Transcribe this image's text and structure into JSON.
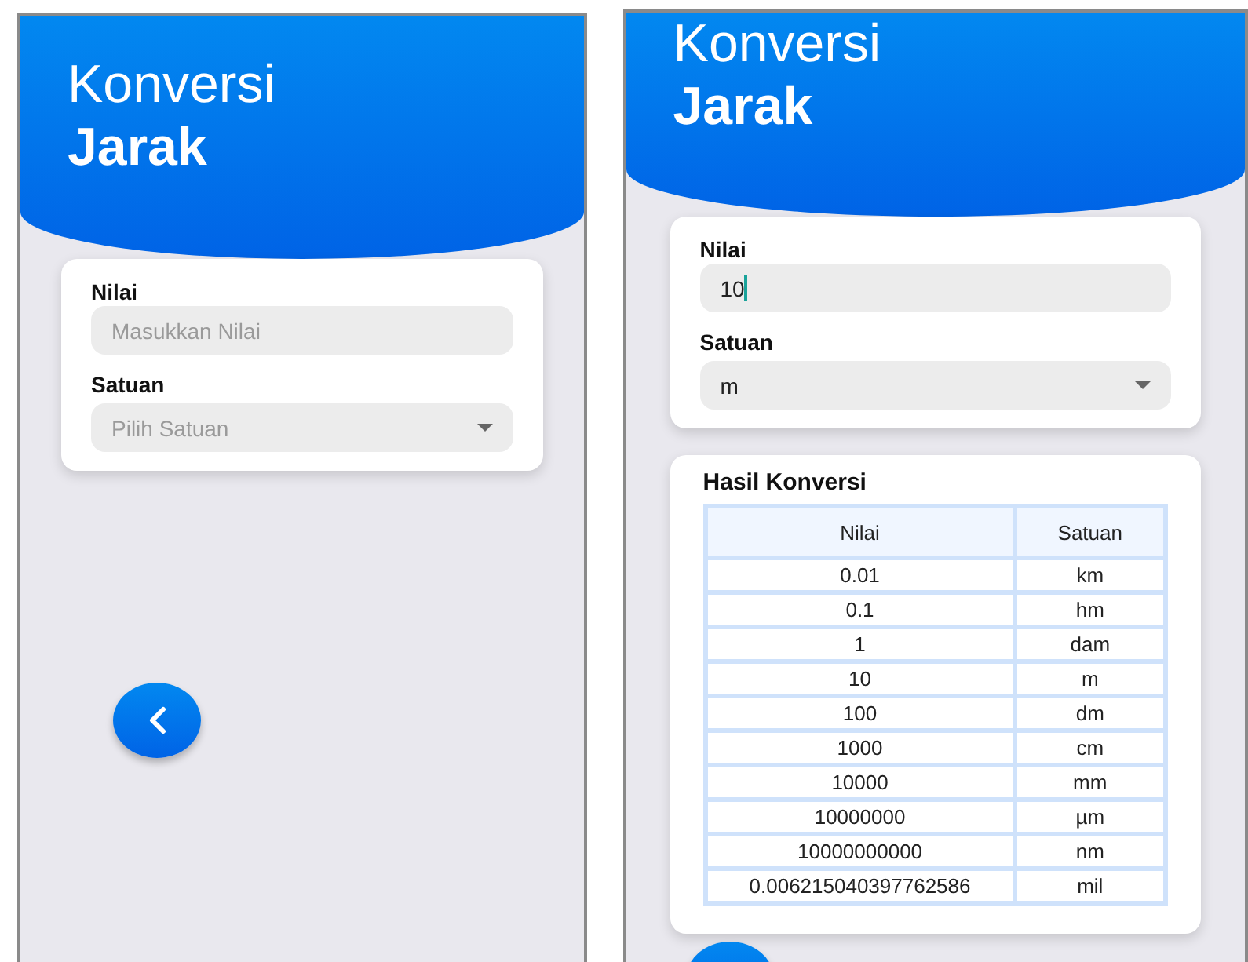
{
  "screens": [
    {
      "title_line1": "Konversi",
      "title_line2": "Jarak",
      "form": {
        "fields": [
          {
            "kind": "input",
            "label": "Nilai",
            "placeholder": "Masukkan Nilai",
            "focused": false
          },
          {
            "kind": "select",
            "label": "Satuan",
            "placeholder": "Pilih Satuan"
          }
        ]
      }
    },
    {
      "title_line1": "Konversi",
      "title_line2": "Jarak",
      "form": {
        "fields": [
          {
            "kind": "input",
            "label": "Nilai",
            "value": "10",
            "focused": true
          },
          {
            "kind": "select",
            "label": "Satuan",
            "value": "m"
          }
        ]
      },
      "result": {
        "title": "Hasil Konversi",
        "columns": [
          "Nilai",
          "Satuan"
        ],
        "rows": [
          [
            "0.01",
            "km"
          ],
          [
            "0.1",
            "hm"
          ],
          [
            "1",
            "dam"
          ],
          [
            "10",
            "m"
          ],
          [
            "100",
            "dm"
          ],
          [
            "1000",
            "cm"
          ],
          [
            "10000",
            "mm"
          ],
          [
            "10000000",
            "µm"
          ],
          [
            "10000000000",
            "nm"
          ],
          [
            "0.006215040397762586",
            "mil"
          ]
        ]
      }
    }
  ]
}
